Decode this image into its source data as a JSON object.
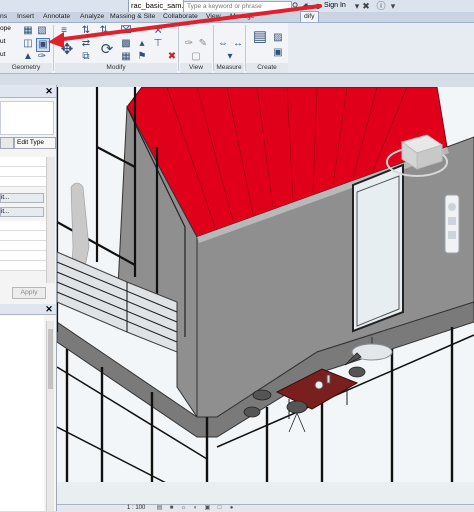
{
  "titlebar": {
    "document_title": "rac_basic_sam...",
    "search_placeholder": "Type a keyword or phrase",
    "signin_label": "Sign In",
    "icons": [
      "binoculars-icon",
      "comm-center-icon",
      "favorites-icon",
      "user-icon",
      "dropdown-icon",
      "help-icon"
    ]
  },
  "ribbon": {
    "tabs": [
      {
        "label": "ns"
      },
      {
        "label": "Insert"
      },
      {
        "label": "Annotate"
      },
      {
        "label": "Analyze"
      },
      {
        "label": "Massing & Site"
      },
      {
        "label": "Collaborate"
      },
      {
        "label": "View"
      },
      {
        "label": "Manage"
      },
      {
        "label": "dify",
        "active": true
      }
    ],
    "panels": {
      "geometry": "Geometry",
      "modify": "Modify",
      "view": "View",
      "measure": "Measure",
      "create": "Create"
    },
    "left_labels": [
      "ope",
      "ut",
      "ut"
    ],
    "annotation_arrow_color": "#e0202a"
  },
  "properties": {
    "edit_type_label": "Edit Type",
    "apply_label": "Apply",
    "row_buttons": [
      "it...",
      "it..."
    ]
  },
  "viewport": {
    "roof_color": "#e0001a",
    "wall_color": "#8f8f8f",
    "scale_label": "1 : 100"
  }
}
